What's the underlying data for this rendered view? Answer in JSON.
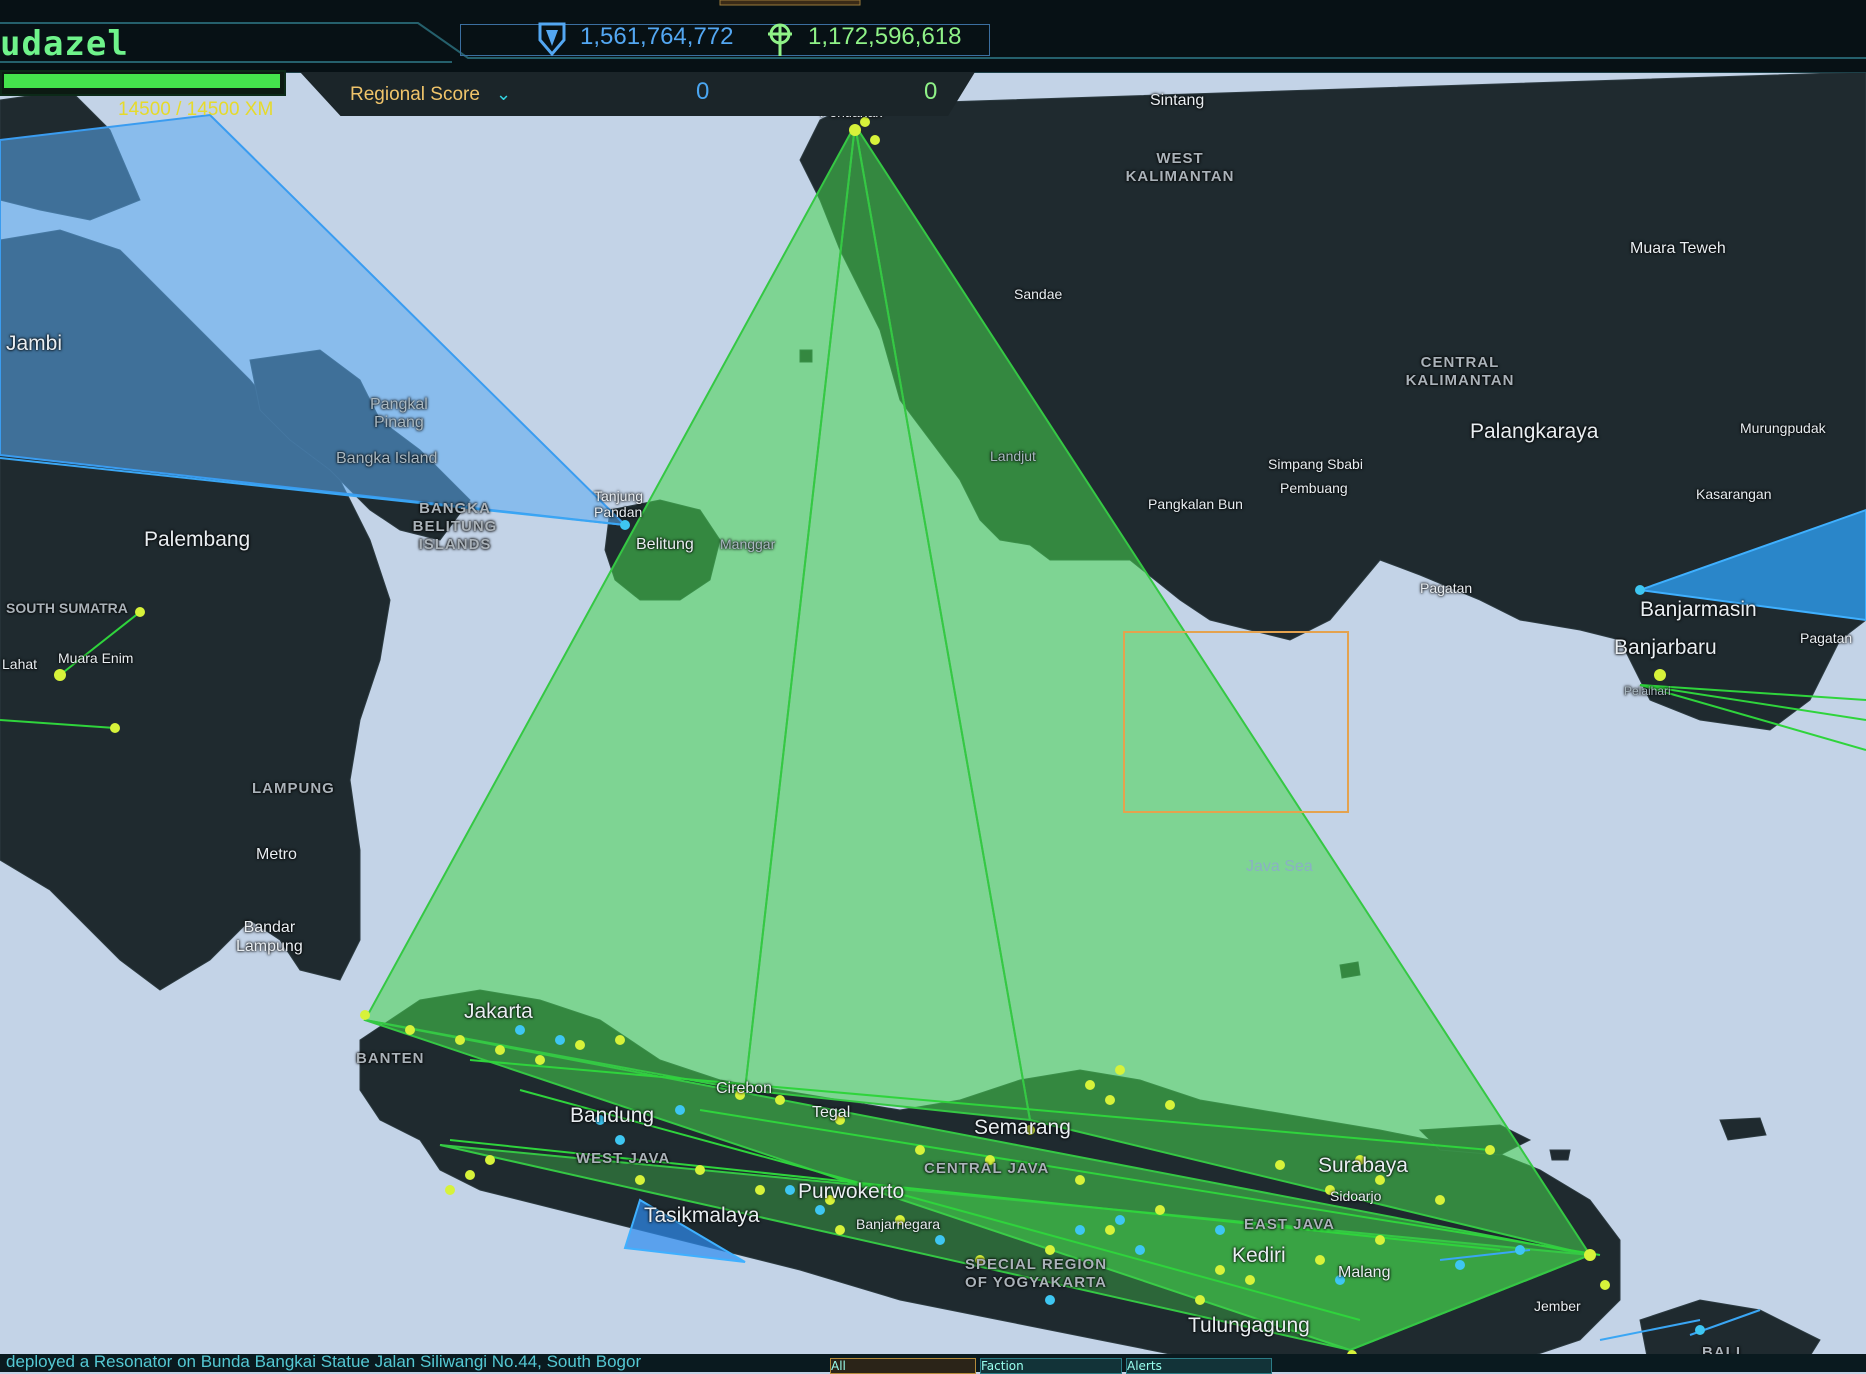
{
  "agent": {
    "name": "udazel",
    "xm_text": "14500 / 14500 XM",
    "xm_fraction": 1.0
  },
  "global_score": {
    "resistance": "1,561,764,772",
    "enlightened": "1,172,596,618"
  },
  "regional": {
    "label": "Regional Score",
    "resistance": "0",
    "enlightened": "0"
  },
  "map_labels": {
    "sintang": "Sintang",
    "west_kalimantan": "WEST\nKALIMANTAN",
    "pontianak": "Pontianak",
    "muara_teweh": "Muara Teweh",
    "sandae": "Sandae",
    "central_kalimantan": "CENTRAL\nKALIMANTAN",
    "palangkaraya": "Palangkaraya",
    "murungpudak": "Murungpudak",
    "simpang_sbabi": "Simpang Sbabi",
    "pembuang": "Pembuang",
    "pangkalan_bun": "Pangkalan Bun",
    "kasarangan": "Kasarangan",
    "landjut": "Landjut",
    "jambi": "Jambi",
    "pangkal_pinang": "Pangkal\nPinang",
    "bangka_island": "Bangka Island",
    "tanjung_pandan": "Tanjung\nPandan",
    "bangka_belitung": "BANGKA\nBELITUNG\nISLANDS",
    "belitung": "Belitung",
    "manggar": "Manggar",
    "palembang": "Palembang",
    "south_sumatra": "SOUTH SUMATRA",
    "lahat": "Lahat",
    "muara_enim": "Muara Enim",
    "lampung": "LAMPUNG",
    "metro": "Metro",
    "bandar_lampung": "Bandar\nLampung",
    "pagatan": "Pagatan",
    "banjarmasin": "Banjarmasin",
    "banjarbaru": "Banjarbaru",
    "pagatan2": "Pagatan",
    "pelaihari": "Pelaihari",
    "java_sea": "Java Sea",
    "jakarta": "Jakarta",
    "banten": "BANTEN",
    "cirebon": "Cirebon",
    "tegal": "Tegal",
    "bandung": "Bandung",
    "west_java": "WEST JAVA",
    "semarang": "Semarang",
    "central_java": "CENTRAL JAVA",
    "surabaya": "Surabaya",
    "sidoarjo": "Sidoarjo",
    "purwokerto": "Purwokerto",
    "banjarnegara": "Banjarnegara",
    "tasikmalaya": "Tasikmalaya",
    "east_java": "EAST JAVA",
    "special_region": "SPECIAL REGION\nOF YOGYAKARTA",
    "kediri": "Kediri",
    "malang": "Malang",
    "jember": "Jember",
    "tulungagung": "Tulungagung",
    "bali": "BALI"
  },
  "ticker": {
    "text": "deployed a Resonator on Bunda Bangkai Statue Jalan Siliwangi No.44, South Bogor"
  },
  "tabs": {
    "all": "All",
    "faction": "Faction",
    "alerts": "Alerts"
  },
  "colors": {
    "enlightened": "#45d64e",
    "resistance": "#2d9df0",
    "portal": "#d7f23a",
    "land": "#1e292e",
    "water": "#c3d3e7"
  }
}
